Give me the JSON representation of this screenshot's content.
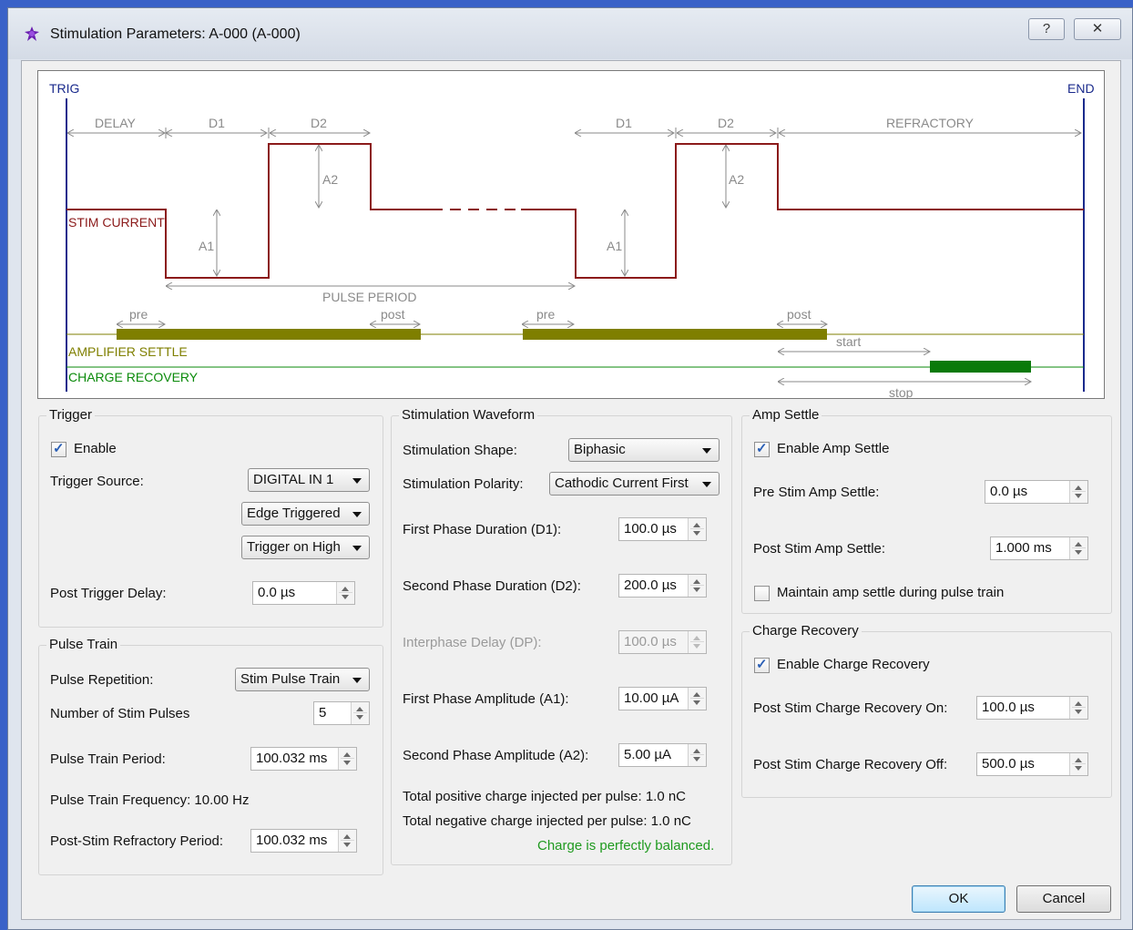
{
  "window": {
    "title": "Stimulation Parameters: A-000 (A-000)",
    "help_label": "?",
    "close_label": "✕"
  },
  "diagram": {
    "trig": "TRIG",
    "end": "END",
    "delay": "DELAY",
    "d1": "D1",
    "d2": "D2",
    "refractory": "REFRACTORY",
    "a1": "A1",
    "a2": "A2",
    "stim_current": "STIM CURRENT",
    "pulse_period": "PULSE PERIOD",
    "pre": "pre",
    "post": "post",
    "amp_settle": "AMPLIFIER SETTLE",
    "charge_recovery": "CHARGE RECOVERY",
    "start": "start",
    "stop": "stop",
    "colors": {
      "stim": "#8b1a1a",
      "amp": "#7f7f00",
      "charge": "#0a8a0a",
      "markers": "#1a2a8c",
      "annot": "#8a8a8a"
    }
  },
  "trigger": {
    "title": "Trigger",
    "enable_label": "Enable",
    "enable_checked": true,
    "source_label": "Trigger Source:",
    "source_value": "DIGITAL IN 1",
    "edge_value": "Edge Triggered",
    "level_value": "Trigger on High",
    "delay_label": "Post Trigger Delay:",
    "delay_value": "0.0 µs"
  },
  "pulse_train": {
    "title": "Pulse Train",
    "repetition_label": "Pulse Repetition:",
    "repetition_value": "Stim Pulse Train",
    "num_pulses_label": "Number of Stim Pulses",
    "num_pulses_value": "5",
    "period_label": "Pulse Train Period:",
    "period_value": "100.032 ms",
    "frequency_text": "Pulse Train Frequency: 10.00 Hz",
    "refractory_label": "Post-Stim Refractory Period:",
    "refractory_value": "100.032 ms"
  },
  "waveform": {
    "title": "Stimulation Waveform",
    "shape_label": "Stimulation Shape:",
    "shape_value": "Biphasic",
    "polarity_label": "Stimulation Polarity:",
    "polarity_value": "Cathodic Current First",
    "d1_label": "First Phase Duration (D1):",
    "d1_value": "100.0 µs",
    "d2_label": "Second Phase Duration (D2):",
    "d2_value": "200.0 µs",
    "dp_label": "Interphase Delay (DP):",
    "dp_value": "100.0 µs",
    "a1_label": "First Phase Amplitude (A1):",
    "a1_value": "10.00 µA",
    "a2_label": "Second Phase Amplitude (A2):",
    "a2_value": "5.00 µA",
    "pos_charge": "Total positive charge injected per pulse: 1.0 nC",
    "neg_charge": "Total negative charge injected per pulse: 1.0 nC",
    "balance": "Charge is perfectly balanced."
  },
  "amp_settle": {
    "title": "Amp Settle",
    "enable_label": "Enable Amp Settle",
    "enable_checked": true,
    "pre_label": "Pre Stim Amp Settle:",
    "pre_value": "0.0 µs",
    "post_label": "Post Stim Amp Settle:",
    "post_value": "1.000 ms",
    "maintain_label": "Maintain amp settle during pulse train",
    "maintain_checked": false
  },
  "charge_recovery": {
    "title": "Charge Recovery",
    "enable_label": "Enable Charge Recovery",
    "enable_checked": true,
    "on_label": "Post Stim Charge Recovery On:",
    "on_value": "100.0 µs",
    "off_label": "Post Stim Charge Recovery Off:",
    "off_value": "500.0 µs"
  },
  "buttons": {
    "ok": "OK",
    "cancel": "Cancel"
  }
}
